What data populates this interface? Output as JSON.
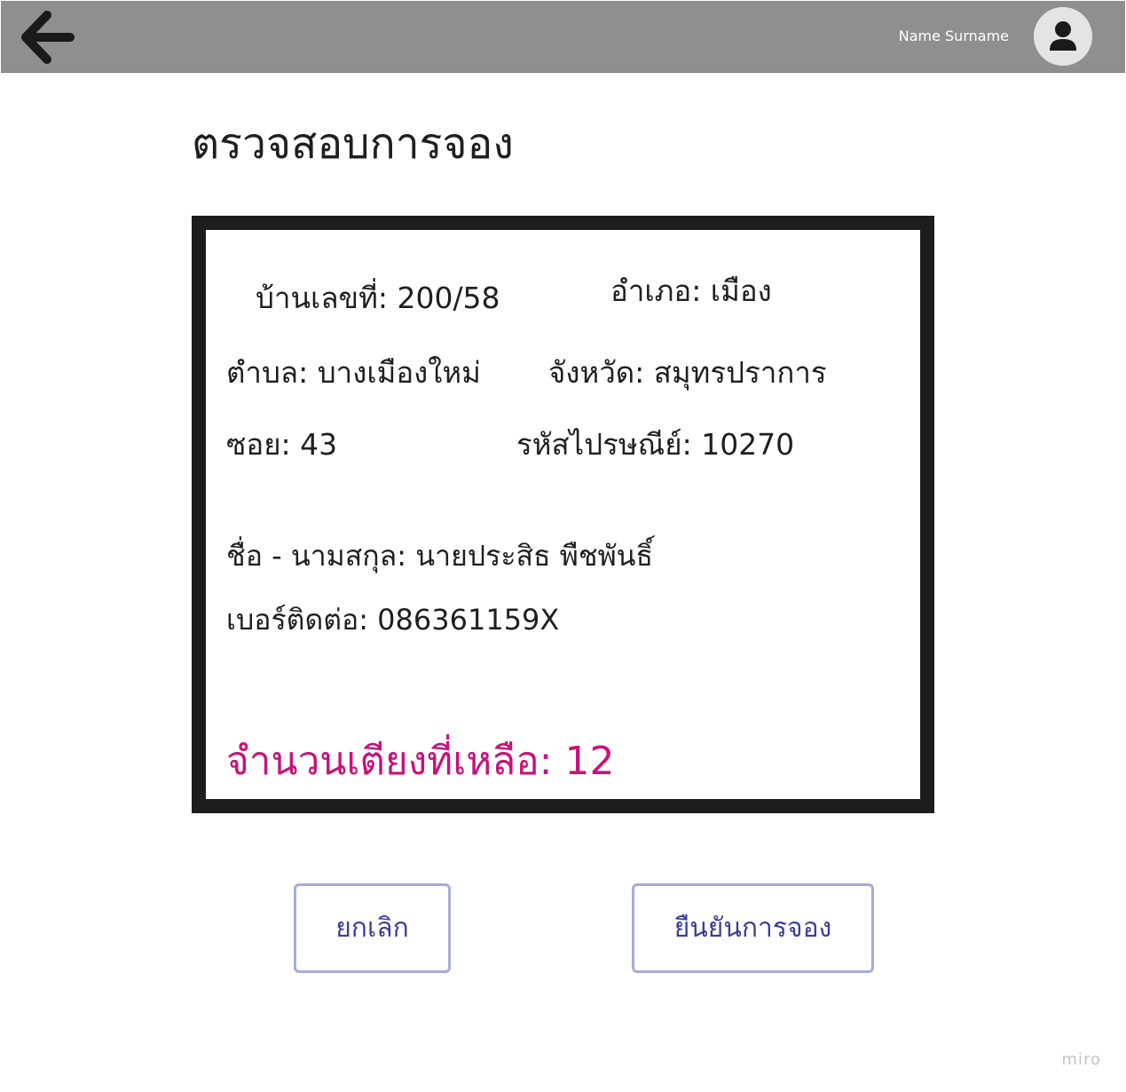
{
  "header": {
    "user_name": "Name Surname",
    "back_icon": "arrow-left-icon",
    "avatar_icon": "user-icon",
    "background_color": "#8f8f8f"
  },
  "page": {
    "title": "ตรวจสอบการจอง"
  },
  "booking": {
    "house_no": "บ้านเลขที่: 200/58",
    "district": "อำเภอ: เมือง",
    "subdistrict": "ตำบล: บางเมืองใหม่",
    "province": "จังหวัด: สมุทรปราการ",
    "soi": "ซอย: 43",
    "postal_code": "รหัสไปรษณีย์: 10270",
    "full_name": "ชื่อ - นามสกุล: นายประสิธ พืชพันธิ์",
    "phone": "เบอร์ติดต่อ: 086361159X",
    "beds_remaining": "จำนวนเตียงที่เหลือ: 12",
    "beds_remaining_color": "#c8127a"
  },
  "actions": {
    "cancel_label": "ยกเลิก",
    "confirm_label": "ยืนยันการจอง",
    "button_border_color": "#a6abdb",
    "button_text_color": "#3a3e96"
  },
  "watermark": "miro"
}
